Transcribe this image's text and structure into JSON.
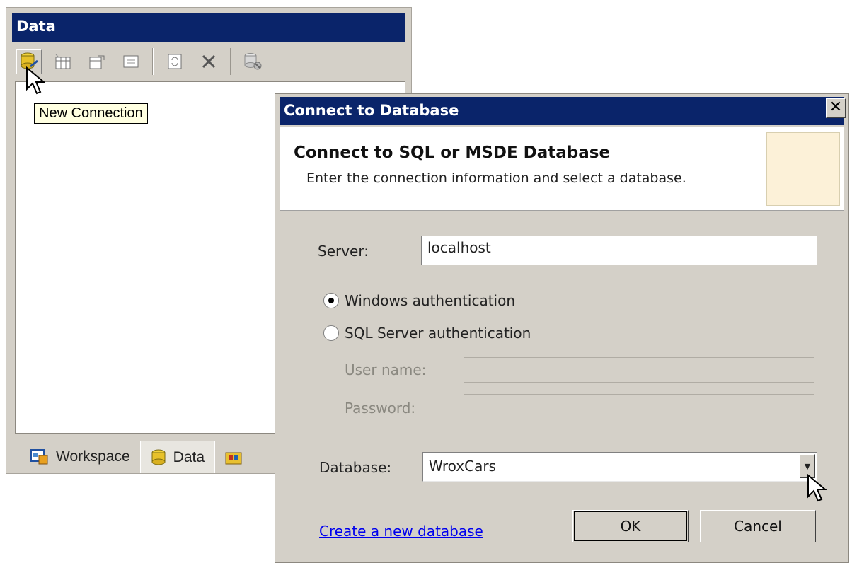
{
  "data_panel": {
    "title": "Data",
    "tooltip": "New Connection",
    "toolbar": [
      "new-connection-icon",
      "table-icon",
      "edit-icon",
      "grid-icon",
      "refresh-icon",
      "delete-icon",
      "disconnect-icon"
    ],
    "tabs": [
      {
        "label": "Workspace",
        "icon": "workspace-icon",
        "selected": false
      },
      {
        "label": "Data",
        "icon": "database-icon",
        "selected": true
      },
      {
        "label": "",
        "icon": "toolbox-icon",
        "selected": false
      }
    ]
  },
  "dialog": {
    "title": "Connect to Database",
    "header_title": "Connect to SQL or MSDE Database",
    "header_subtitle": "Enter the connection information and select a database.",
    "server_label": "Server:",
    "server_value": "localhost",
    "auth_windows": "Windows authentication",
    "auth_sql": "SQL Server authentication",
    "auth_selected": "windows",
    "username_label": "User name:",
    "password_label": "Password:",
    "database_label": "Database:",
    "database_value": "WroxCars",
    "create_link": "Create a new database",
    "ok_label": "OK",
    "cancel_label": "Cancel"
  },
  "colors": {
    "titlebar": "#0a246a",
    "dialog_face": "#d4d0c8",
    "link": "#0000ee",
    "tooltip_bg": "#ffffe1"
  }
}
